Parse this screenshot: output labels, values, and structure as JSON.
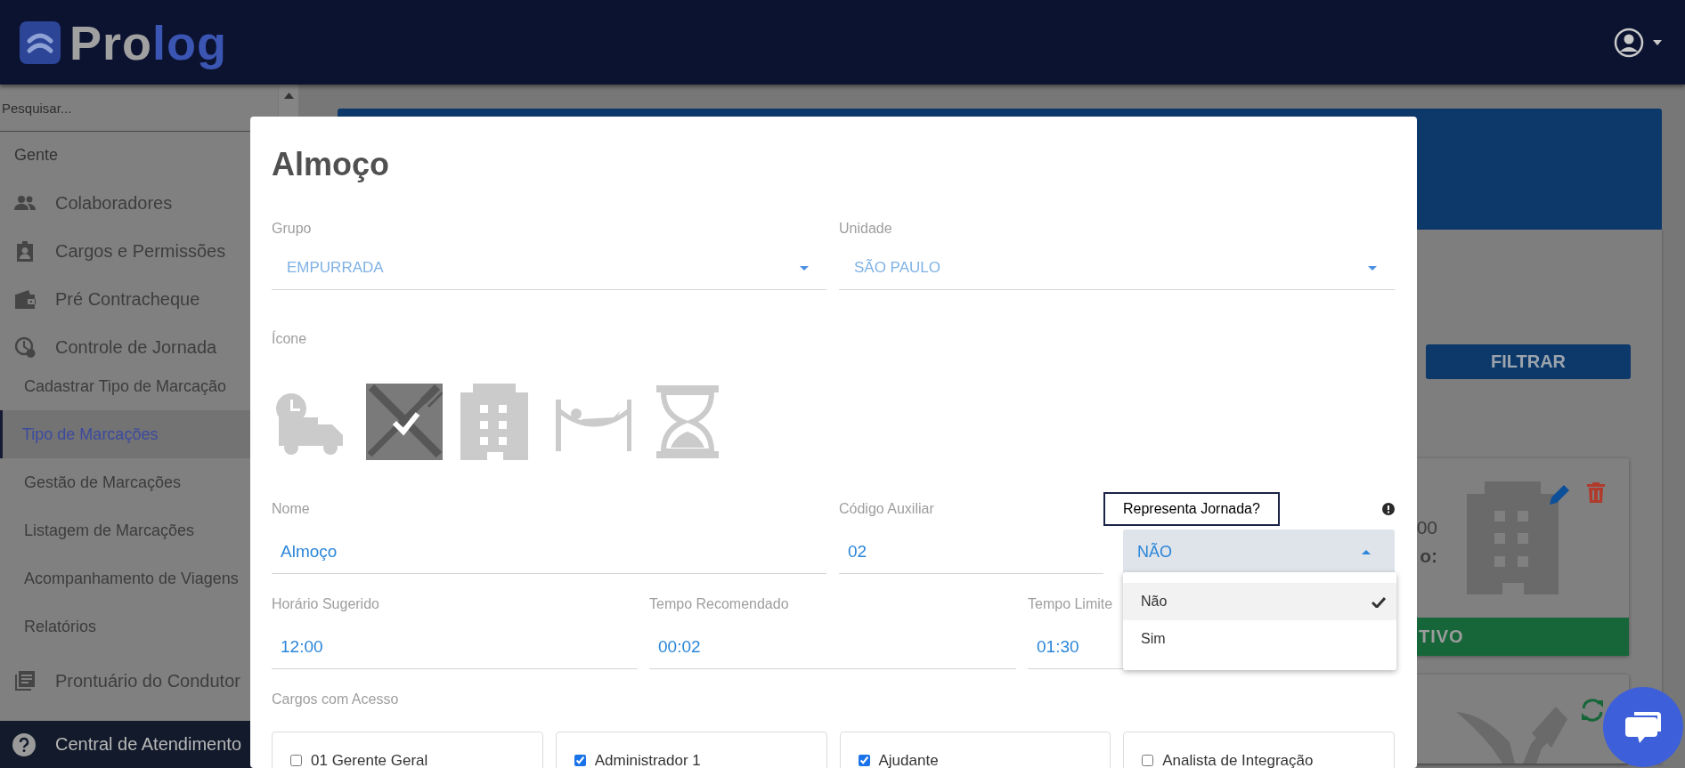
{
  "header": {
    "logo": [
      "Pro",
      "log"
    ]
  },
  "sidebar": {
    "search": {
      "placeholder": "Pesquisar..."
    },
    "section": "Gente",
    "items": [
      {
        "label": "Colaboradores"
      },
      {
        "label": "Cargos e Permissões"
      },
      {
        "label": "Pré Contracheque"
      },
      {
        "label": "Controle de Jornada",
        "children": [
          {
            "label": "Cadastrar Tipo de Marcação",
            "selected": false
          },
          {
            "label": "Tipo de Marcações",
            "selected": true
          },
          {
            "label": "Gestão de Marcações",
            "selected": false
          },
          {
            "label": "Listagem de Marcações",
            "selected": false
          },
          {
            "label": "Acompanhamento de Viagens",
            "selected": false
          },
          {
            "label": "Relatórios",
            "selected": false
          }
        ]
      },
      {
        "label": "Prontuário do Condutor"
      }
    ],
    "help": "Central de Atendimento"
  },
  "background": {
    "filter_button": "FILTRAR",
    "card": {
      "text_1": "00",
      "text_2": "o:",
      "status": "TIVO"
    }
  },
  "modal": {
    "title": "Almoço",
    "grupo": {
      "label": "Grupo",
      "value": "EMPURRADA"
    },
    "unidade": {
      "label": "Unidade",
      "value": "SÃO PAULO"
    },
    "icone": {
      "label": "Ícone",
      "options": [
        {
          "selected": false
        },
        {
          "selected": true
        },
        {
          "selected": false
        },
        {
          "selected": false
        },
        {
          "selected": false
        }
      ]
    },
    "nome": {
      "label": "Nome",
      "value": "Almoço"
    },
    "codigo_auxiliar": {
      "label": "Código Auxiliar",
      "value": "02"
    },
    "representa_jornada": {
      "label": "Representa Jornada?",
      "focused": true,
      "value": "NÃO",
      "expanded": true,
      "options": [
        {
          "label": "Não",
          "selected": true
        },
        {
          "label": "Sim",
          "selected": false
        }
      ]
    },
    "horario_sugerido": {
      "label": "Horário Sugerido",
      "value": "12:00"
    },
    "tempo_recomendado": {
      "label": "Tempo Recomendado",
      "value": "00:02"
    },
    "tempo_limite": {
      "label": "Tempo Limite",
      "value": "01:30"
    },
    "cargos": {
      "label": "Cargos com Acesso",
      "items": [
        {
          "label": "01 Gerente Geral",
          "checked": false
        },
        {
          "label": "Administrador 1",
          "checked": true
        },
        {
          "label": "Ajudante",
          "checked": true
        },
        {
          "label": "Analista de Integração",
          "checked": false
        }
      ]
    }
  }
}
